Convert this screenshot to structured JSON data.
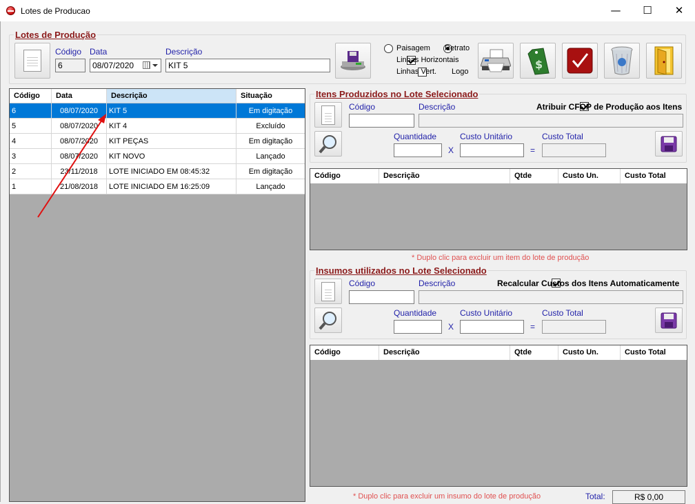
{
  "window": {
    "title": "Lotes de Producao",
    "minimize": "—",
    "maximize": "☐",
    "close": "✕"
  },
  "header": {
    "group_title": "Lotes de Produção",
    "codigo_label": "Código",
    "codigo_value": "6",
    "data_label": "Data",
    "data_value": "08/07/2020",
    "descricao_label": "Descrição",
    "descricao_value": "KIT 5",
    "paisagem": "Paisagem",
    "retrato": "Retrato",
    "linhas_horizontais": "Linhas Horizontais",
    "linhas_vert": "Linhas Vert.",
    "logo": "Logo"
  },
  "lotes_table": {
    "columns": [
      "Código",
      "Data",
      "Descrição",
      "Situação"
    ],
    "rows": [
      {
        "codigo": "6",
        "data": "08/07/2020",
        "descricao": "KIT 5",
        "situacao": "Em digitação"
      },
      {
        "codigo": "5",
        "data": "08/07/2020",
        "descricao": "KIT 4",
        "situacao": "Excluído"
      },
      {
        "codigo": "4",
        "data": "08/07/2020",
        "descricao": "KIT PEÇAS",
        "situacao": "Em digitação"
      },
      {
        "codigo": "3",
        "data": "08/07/2020",
        "descricao": "KIT NOVO",
        "situacao": "Lançado"
      },
      {
        "codigo": "2",
        "data": "23/11/2018",
        "descricao": "LOTE INICIADO EM 08:45:32",
        "situacao": "Em digitação"
      },
      {
        "codigo": "1",
        "data": "21/08/2018",
        "descricao": "LOTE INICIADO EM 16:25:09",
        "situacao": "Lançado"
      }
    ]
  },
  "itens": {
    "group_title": "Itens Produzidos no Lote Selecionado",
    "codigo_label": "Código",
    "descricao_label": "Descrição",
    "cfop_label": "Atribuir CFOP de Produção aos Itens",
    "quantidade_label": "Quantidade",
    "custo_unit_label": "Custo Unitário",
    "custo_total_label": "Custo Total",
    "times": "X",
    "equals": "=",
    "columns": [
      "Código",
      "Descrição",
      "Qtde",
      "Custo Un.",
      "Custo Total"
    ],
    "note": "* Duplo clic para excluir um item do lote de produção"
  },
  "insumos": {
    "group_title": "Insumos utilizados no Lote Selecionado",
    "codigo_label": "Código",
    "descricao_label": "Descrição",
    "recalc_label": "Recalcular Custos dos Itens Automaticamente",
    "quantidade_label": "Quantidade",
    "custo_unit_label": "Custo Unitário",
    "custo_total_label": "Custo Total",
    "times": "X",
    "equals": "=",
    "columns": [
      "Código",
      "Descrição",
      "Qtde",
      "Custo Un.",
      "Custo Total"
    ],
    "note": "* Duplo clic para excluir um insumo do lote de produção",
    "total_label": "Total:",
    "total_value": "R$ 0,00"
  },
  "icons": [
    "new-document-icon",
    "save-disk-icon",
    "printer-icon",
    "price-tag-icon",
    "checkmark-icon",
    "recycle-bin-icon",
    "exit-door-icon",
    "magnifier-icon",
    "floppy-disk-icon",
    "calendar-icon"
  ]
}
